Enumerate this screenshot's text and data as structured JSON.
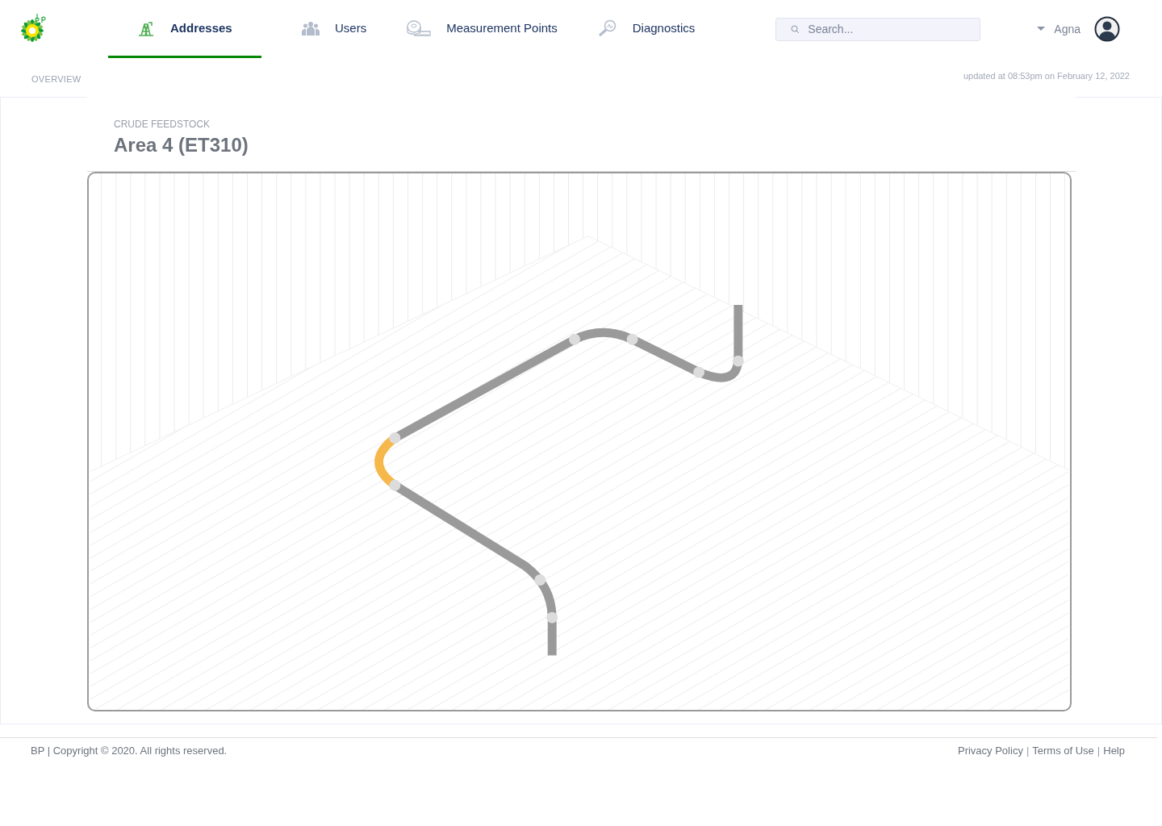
{
  "header": {
    "tabs": [
      {
        "label": "Addresses",
        "selected": true
      },
      {
        "label": "Users",
        "selected": false
      },
      {
        "label": "Measurement Points",
        "selected": false
      },
      {
        "label": "Diagnostics",
        "selected": false
      }
    ],
    "search": {
      "placeholder": "Search..."
    },
    "user": {
      "name": "Agna"
    }
  },
  "subheader": {
    "breadcrumb": "OVERVIEW",
    "updated": "updated at 08:53pm on February 12, 2022"
  },
  "area": {
    "category": "CRUDE FEEDSTOCK",
    "title": "Area 4 (ET310)"
  },
  "pipe_segments": [
    {
      "color": "#9a9a9a"
    },
    {
      "color": "#f6b84a"
    },
    {
      "color": "#9a9a9a"
    }
  ],
  "footer": {
    "copyright": "BP |  Copyright © 2020. All rights reserved.",
    "items": [
      {
        "kind": "link",
        "text": "Privacy Policy"
      },
      {
        "kind": "separator",
        "text": "|"
      },
      {
        "kind": "link",
        "text": "Terms of Use"
      },
      {
        "kind": "separator",
        "text": "|"
      },
      {
        "kind": "link",
        "text": "Help"
      }
    ]
  }
}
